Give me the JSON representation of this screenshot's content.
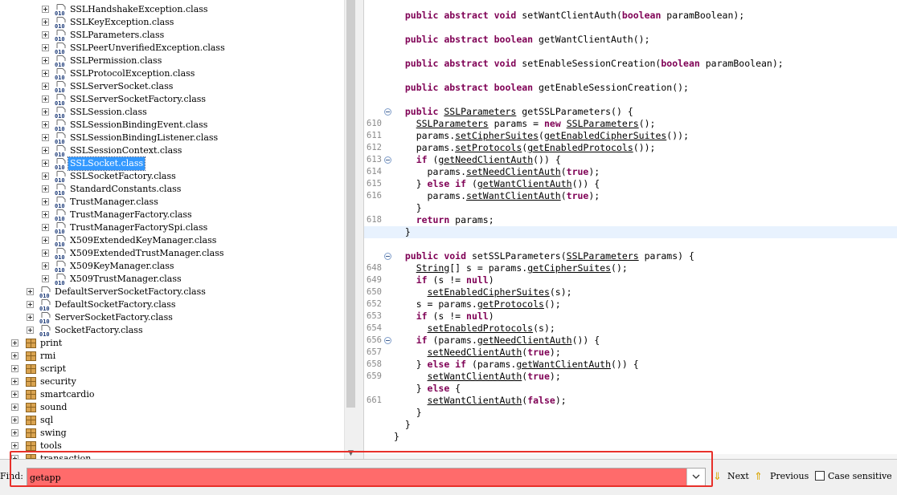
{
  "tree": {
    "nested_items": [
      {
        "label": "SSLHandshakeException.class"
      },
      {
        "label": "SSLKeyException.class"
      },
      {
        "label": "SSLParameters.class"
      },
      {
        "label": "SSLPeerUnverifiedException.class"
      },
      {
        "label": "SSLPermission.class"
      },
      {
        "label": "SSLProtocolException.class"
      },
      {
        "label": "SSLServerSocket.class"
      },
      {
        "label": "SSLServerSocketFactory.class"
      },
      {
        "label": "SSLSession.class"
      },
      {
        "label": "SSLSessionBindingEvent.class"
      },
      {
        "label": "SSLSessionBindingListener.class"
      },
      {
        "label": "SSLSessionContext.class"
      },
      {
        "label": "SSLSocket.class",
        "selected": true
      },
      {
        "label": "SSLSocketFactory.class"
      },
      {
        "label": "StandardConstants.class"
      },
      {
        "label": "TrustManager.class"
      },
      {
        "label": "TrustManagerFactory.class"
      },
      {
        "label": "TrustManagerFactorySpi.class"
      },
      {
        "label": "X509ExtendedKeyManager.class"
      },
      {
        "label": "X509ExtendedTrustManager.class"
      },
      {
        "label": "X509KeyManager.class"
      },
      {
        "label": "X509TrustManager.class"
      }
    ],
    "class_items": [
      {
        "label": "DefaultServerSocketFactory.class"
      },
      {
        "label": "DefaultSocketFactory.class"
      },
      {
        "label": "ServerSocketFactory.class"
      },
      {
        "label": "SocketFactory.class"
      }
    ],
    "packages": [
      {
        "label": "print"
      },
      {
        "label": "rmi"
      },
      {
        "label": "script"
      },
      {
        "label": "security"
      },
      {
        "label": "smartcardio"
      },
      {
        "label": "sound"
      },
      {
        "label": "sql"
      },
      {
        "label": "swing"
      },
      {
        "label": "tools"
      },
      {
        "label": "transaction"
      }
    ],
    "icon_text": "010"
  },
  "code": {
    "lines": [
      {
        "n": "",
        "t": [
          [
            "  "
          ],
          [
            "public abstract void",
            "kw"
          ],
          [
            " setWantClientAuth("
          ],
          [
            "boolean",
            "kw"
          ],
          [
            " paramBoolean);"
          ]
        ]
      },
      {
        "n": "",
        "t": [
          [
            ""
          ]
        ]
      },
      {
        "n": "",
        "t": [
          [
            "  "
          ],
          [
            "public abstract boolean",
            "kw"
          ],
          [
            " getWantClientAuth();"
          ]
        ]
      },
      {
        "n": "",
        "t": [
          [
            ""
          ]
        ]
      },
      {
        "n": "",
        "t": [
          [
            "  "
          ],
          [
            "public abstract void",
            "kw"
          ],
          [
            " setEnableSessionCreation("
          ],
          [
            "boolean",
            "kw"
          ],
          [
            " paramBoolean);"
          ]
        ]
      },
      {
        "n": "",
        "t": [
          [
            ""
          ]
        ]
      },
      {
        "n": "",
        "t": [
          [
            "  "
          ],
          [
            "public abstract boolean",
            "kw"
          ],
          [
            " getEnableSessionCreation();"
          ]
        ]
      },
      {
        "n": "",
        "t": [
          [
            ""
          ]
        ]
      },
      {
        "n": "",
        "fold": true,
        "t": [
          [
            "  "
          ],
          [
            "public",
            "kw"
          ],
          [
            " "
          ],
          [
            "SSLParameters",
            "ul"
          ],
          [
            " getSSLParameters() {"
          ]
        ]
      },
      {
        "n": "610",
        "t": [
          [
            "    "
          ],
          [
            "SSLParameters",
            "ul"
          ],
          [
            " params = "
          ],
          [
            "new",
            "kw"
          ],
          [
            " "
          ],
          [
            "SSLParameters",
            "ul"
          ],
          [
            "();"
          ]
        ]
      },
      {
        "n": "611",
        "t": [
          [
            "    params."
          ],
          [
            "setCipherSuites",
            "ul"
          ],
          [
            "("
          ],
          [
            "getEnabledCipherSuites",
            "ul"
          ],
          [
            "());"
          ]
        ]
      },
      {
        "n": "612",
        "t": [
          [
            "    params."
          ],
          [
            "setProtocols",
            "ul"
          ],
          [
            "("
          ],
          [
            "getEnabledProtocols",
            "ul"
          ],
          [
            "());"
          ]
        ]
      },
      {
        "n": "613",
        "fold": true,
        "t": [
          [
            "    "
          ],
          [
            "if",
            "kw"
          ],
          [
            " ("
          ],
          [
            "getNeedClientAuth",
            "ul"
          ],
          [
            "()) {"
          ]
        ]
      },
      {
        "n": "614",
        "t": [
          [
            "      params."
          ],
          [
            "setNeedClientAuth",
            "ul"
          ],
          [
            "("
          ],
          [
            "true",
            "kw"
          ],
          [
            ");"
          ]
        ]
      },
      {
        "n": "615",
        "t": [
          [
            "    } "
          ],
          [
            "else if",
            "kw"
          ],
          [
            " ("
          ],
          [
            "getWantClientAuth",
            "ul"
          ],
          [
            "()) {"
          ]
        ]
      },
      {
        "n": "616",
        "t": [
          [
            "      params."
          ],
          [
            "setWantClientAuth",
            "ul"
          ],
          [
            "("
          ],
          [
            "true",
            "kw"
          ],
          [
            ");"
          ]
        ]
      },
      {
        "n": "",
        "t": [
          [
            "    }"
          ]
        ]
      },
      {
        "n": "618",
        "t": [
          [
            "    "
          ],
          [
            "return",
            "kw"
          ],
          [
            " params;"
          ]
        ]
      },
      {
        "n": "",
        "hl": true,
        "t": [
          [
            "  }"
          ]
        ]
      },
      {
        "n": "",
        "t": [
          [
            ""
          ]
        ]
      },
      {
        "n": "",
        "fold": true,
        "t": [
          [
            "  "
          ],
          [
            "public void",
            "kw"
          ],
          [
            " setSSLParameters("
          ],
          [
            "SSLParameters",
            "ul"
          ],
          [
            " params) {"
          ]
        ]
      },
      {
        "n": "648",
        "t": [
          [
            "    "
          ],
          [
            "String",
            "ul"
          ],
          [
            "[] s = params."
          ],
          [
            "getCipherSuites",
            "ul"
          ],
          [
            "();"
          ]
        ]
      },
      {
        "n": "649",
        "t": [
          [
            "    "
          ],
          [
            "if",
            "kw"
          ],
          [
            " (s != "
          ],
          [
            "null",
            "kw"
          ],
          [
            ")"
          ]
        ]
      },
      {
        "n": "650",
        "t": [
          [
            "      "
          ],
          [
            "setEnabledCipherSuites",
            "ul"
          ],
          [
            "(s);"
          ]
        ]
      },
      {
        "n": "652",
        "t": [
          [
            "    s = params."
          ],
          [
            "getProtocols",
            "ul"
          ],
          [
            "();"
          ]
        ]
      },
      {
        "n": "653",
        "t": [
          [
            "    "
          ],
          [
            "if",
            "kw"
          ],
          [
            " (s != "
          ],
          [
            "null",
            "kw"
          ],
          [
            ")"
          ]
        ]
      },
      {
        "n": "654",
        "t": [
          [
            "      "
          ],
          [
            "setEnabledProtocols",
            "ul"
          ],
          [
            "(s);"
          ]
        ]
      },
      {
        "n": "656",
        "fold": true,
        "t": [
          [
            "    "
          ],
          [
            "if",
            "kw"
          ],
          [
            " (params."
          ],
          [
            "getNeedClientAuth",
            "ul"
          ],
          [
            "()) {"
          ]
        ]
      },
      {
        "n": "657",
        "t": [
          [
            "      "
          ],
          [
            "setNeedClientAuth",
            "ul"
          ],
          [
            "("
          ],
          [
            "true",
            "kw"
          ],
          [
            ");"
          ]
        ]
      },
      {
        "n": "658",
        "t": [
          [
            "    } "
          ],
          [
            "else if",
            "kw"
          ],
          [
            " (params."
          ],
          [
            "getWantClientAuth",
            "ul"
          ],
          [
            "()) {"
          ]
        ]
      },
      {
        "n": "659",
        "t": [
          [
            "      "
          ],
          [
            "setWantClientAuth",
            "ul"
          ],
          [
            "("
          ],
          [
            "true",
            "kw"
          ],
          [
            ");"
          ]
        ]
      },
      {
        "n": "",
        "t": [
          [
            "    } "
          ],
          [
            "else",
            "kw"
          ],
          [
            " {"
          ]
        ]
      },
      {
        "n": "661",
        "t": [
          [
            "      "
          ],
          [
            "setWantClientAuth",
            "ul"
          ],
          [
            "("
          ],
          [
            "false",
            "kw"
          ],
          [
            ");"
          ]
        ]
      },
      {
        "n": "",
        "t": [
          [
            "    }"
          ]
        ]
      },
      {
        "n": "",
        "t": [
          [
            "  }"
          ]
        ]
      },
      {
        "n": "",
        "t": [
          [
            "}"
          ]
        ]
      }
    ]
  },
  "findbar": {
    "label": "Find:",
    "value": "getapp",
    "next_label": "Next",
    "previous_label": "Previous",
    "case_sensitive_label": "Case sensitive",
    "case_sensitive_checked": false,
    "no_match_color": "#ff6b6b"
  },
  "colors": {
    "keyword": "#7f0055",
    "selection": "#3399ff",
    "annotation": "#e8302a"
  }
}
